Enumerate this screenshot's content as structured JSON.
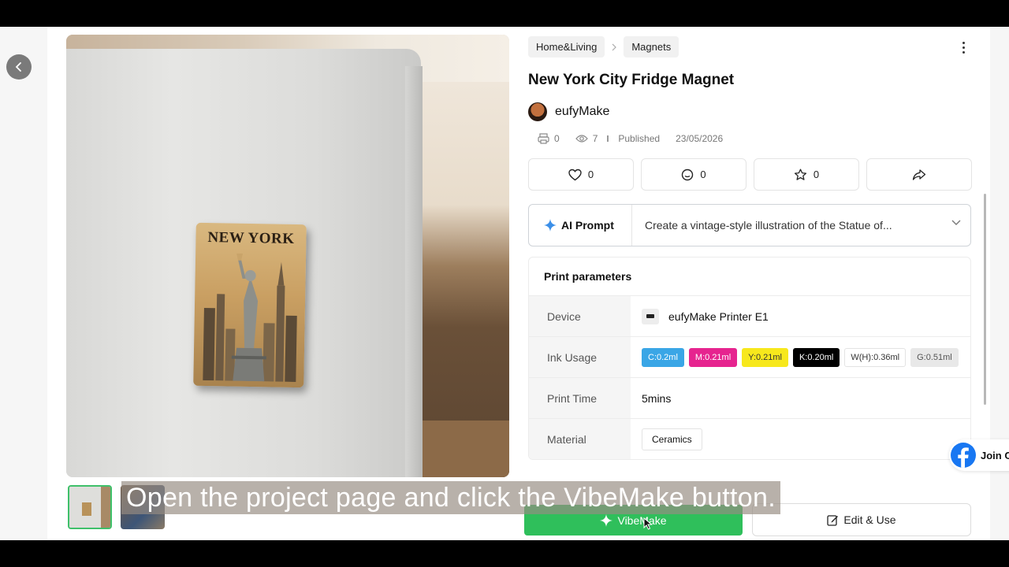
{
  "breadcrumb": [
    "Home&Living",
    "Magnets"
  ],
  "product": {
    "title": "New York City Fridge Magnet",
    "magnet_text": "NEW YORK",
    "author": "eufyMake",
    "prints": "0",
    "views": "7",
    "published_label": "Published",
    "published_date": "23/05/2026"
  },
  "actions": {
    "likes": "0",
    "comments": "0",
    "favorites": "0"
  },
  "ai_prompt": {
    "label": "AI Prompt",
    "text": "Create a vintage-style illustration of the Statue of..."
  },
  "params": {
    "title": "Print parameters",
    "rows": {
      "device": {
        "key": "Device",
        "value": "eufyMake Printer E1"
      },
      "ink": {
        "key": "Ink Usage"
      },
      "time": {
        "key": "Print Time",
        "value": "5mins"
      },
      "material": {
        "key": "Material",
        "value": "Ceramics"
      }
    },
    "inks": [
      {
        "label": "C:0.2ml",
        "bg": "#3aa6e6",
        "fg": "#ffffff"
      },
      {
        "label": "M:0.21ml",
        "bg": "#e6248f",
        "fg": "#ffffff"
      },
      {
        "label": "Y:0.21ml",
        "bg": "#f7e81c",
        "fg": "#333333"
      },
      {
        "label": "K:0.20ml",
        "bg": "#000000",
        "fg": "#ffffff"
      },
      {
        "label": "W(H):0.36ml",
        "bg": "#ffffff",
        "fg": "#333333"
      },
      {
        "label": "G:0.51ml",
        "bg": "#e8e8e8",
        "fg": "#555555"
      }
    ]
  },
  "buttons": {
    "vibemake": "VibeMake",
    "edit_use": "Edit & Use"
  },
  "facebook": {
    "label": "Join C"
  },
  "caption": "Open the project page and click the VibeMake button.",
  "colors": {
    "accent_green": "#2fbf5b",
    "facebook_blue": "#1877f2"
  }
}
